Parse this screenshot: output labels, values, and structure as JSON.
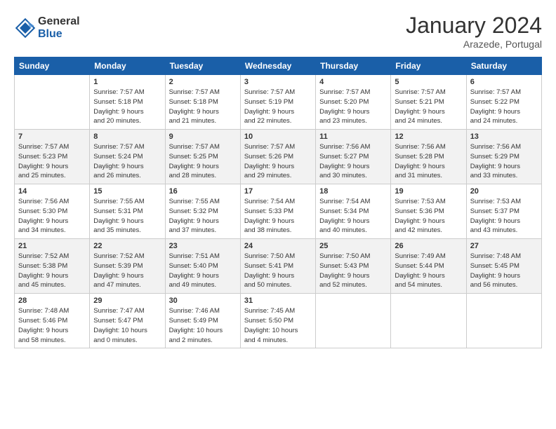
{
  "logo": {
    "general": "General",
    "blue": "Blue"
  },
  "title": "January 2024",
  "location": "Arazede, Portugal",
  "days_header": [
    "Sunday",
    "Monday",
    "Tuesday",
    "Wednesday",
    "Thursday",
    "Friday",
    "Saturday"
  ],
  "weeks": [
    [
      {
        "day": "",
        "content": ""
      },
      {
        "day": "1",
        "content": "Sunrise: 7:57 AM\nSunset: 5:18 PM\nDaylight: 9 hours\nand 20 minutes."
      },
      {
        "day": "2",
        "content": "Sunrise: 7:57 AM\nSunset: 5:18 PM\nDaylight: 9 hours\nand 21 minutes."
      },
      {
        "day": "3",
        "content": "Sunrise: 7:57 AM\nSunset: 5:19 PM\nDaylight: 9 hours\nand 22 minutes."
      },
      {
        "day": "4",
        "content": "Sunrise: 7:57 AM\nSunset: 5:20 PM\nDaylight: 9 hours\nand 23 minutes."
      },
      {
        "day": "5",
        "content": "Sunrise: 7:57 AM\nSunset: 5:21 PM\nDaylight: 9 hours\nand 24 minutes."
      },
      {
        "day": "6",
        "content": "Sunrise: 7:57 AM\nSunset: 5:22 PM\nDaylight: 9 hours\nand 24 minutes."
      }
    ],
    [
      {
        "day": "7",
        "content": "Sunrise: 7:57 AM\nSunset: 5:23 PM\nDaylight: 9 hours\nand 25 minutes."
      },
      {
        "day": "8",
        "content": "Sunrise: 7:57 AM\nSunset: 5:24 PM\nDaylight: 9 hours\nand 26 minutes."
      },
      {
        "day": "9",
        "content": "Sunrise: 7:57 AM\nSunset: 5:25 PM\nDaylight: 9 hours\nand 28 minutes."
      },
      {
        "day": "10",
        "content": "Sunrise: 7:57 AM\nSunset: 5:26 PM\nDaylight: 9 hours\nand 29 minutes."
      },
      {
        "day": "11",
        "content": "Sunrise: 7:56 AM\nSunset: 5:27 PM\nDaylight: 9 hours\nand 30 minutes."
      },
      {
        "day": "12",
        "content": "Sunrise: 7:56 AM\nSunset: 5:28 PM\nDaylight: 9 hours\nand 31 minutes."
      },
      {
        "day": "13",
        "content": "Sunrise: 7:56 AM\nSunset: 5:29 PM\nDaylight: 9 hours\nand 33 minutes."
      }
    ],
    [
      {
        "day": "14",
        "content": "Sunrise: 7:56 AM\nSunset: 5:30 PM\nDaylight: 9 hours\nand 34 minutes."
      },
      {
        "day": "15",
        "content": "Sunrise: 7:55 AM\nSunset: 5:31 PM\nDaylight: 9 hours\nand 35 minutes."
      },
      {
        "day": "16",
        "content": "Sunrise: 7:55 AM\nSunset: 5:32 PM\nDaylight: 9 hours\nand 37 minutes."
      },
      {
        "day": "17",
        "content": "Sunrise: 7:54 AM\nSunset: 5:33 PM\nDaylight: 9 hours\nand 38 minutes."
      },
      {
        "day": "18",
        "content": "Sunrise: 7:54 AM\nSunset: 5:34 PM\nDaylight: 9 hours\nand 40 minutes."
      },
      {
        "day": "19",
        "content": "Sunrise: 7:53 AM\nSunset: 5:36 PM\nDaylight: 9 hours\nand 42 minutes."
      },
      {
        "day": "20",
        "content": "Sunrise: 7:53 AM\nSunset: 5:37 PM\nDaylight: 9 hours\nand 43 minutes."
      }
    ],
    [
      {
        "day": "21",
        "content": "Sunrise: 7:52 AM\nSunset: 5:38 PM\nDaylight: 9 hours\nand 45 minutes."
      },
      {
        "day": "22",
        "content": "Sunrise: 7:52 AM\nSunset: 5:39 PM\nDaylight: 9 hours\nand 47 minutes."
      },
      {
        "day": "23",
        "content": "Sunrise: 7:51 AM\nSunset: 5:40 PM\nDaylight: 9 hours\nand 49 minutes."
      },
      {
        "day": "24",
        "content": "Sunrise: 7:50 AM\nSunset: 5:41 PM\nDaylight: 9 hours\nand 50 minutes."
      },
      {
        "day": "25",
        "content": "Sunrise: 7:50 AM\nSunset: 5:43 PM\nDaylight: 9 hours\nand 52 minutes."
      },
      {
        "day": "26",
        "content": "Sunrise: 7:49 AM\nSunset: 5:44 PM\nDaylight: 9 hours\nand 54 minutes."
      },
      {
        "day": "27",
        "content": "Sunrise: 7:48 AM\nSunset: 5:45 PM\nDaylight: 9 hours\nand 56 minutes."
      }
    ],
    [
      {
        "day": "28",
        "content": "Sunrise: 7:48 AM\nSunset: 5:46 PM\nDaylight: 9 hours\nand 58 minutes."
      },
      {
        "day": "29",
        "content": "Sunrise: 7:47 AM\nSunset: 5:47 PM\nDaylight: 10 hours\nand 0 minutes."
      },
      {
        "day": "30",
        "content": "Sunrise: 7:46 AM\nSunset: 5:49 PM\nDaylight: 10 hours\nand 2 minutes."
      },
      {
        "day": "31",
        "content": "Sunrise: 7:45 AM\nSunset: 5:50 PM\nDaylight: 10 hours\nand 4 minutes."
      },
      {
        "day": "",
        "content": ""
      },
      {
        "day": "",
        "content": ""
      },
      {
        "day": "",
        "content": ""
      }
    ]
  ]
}
